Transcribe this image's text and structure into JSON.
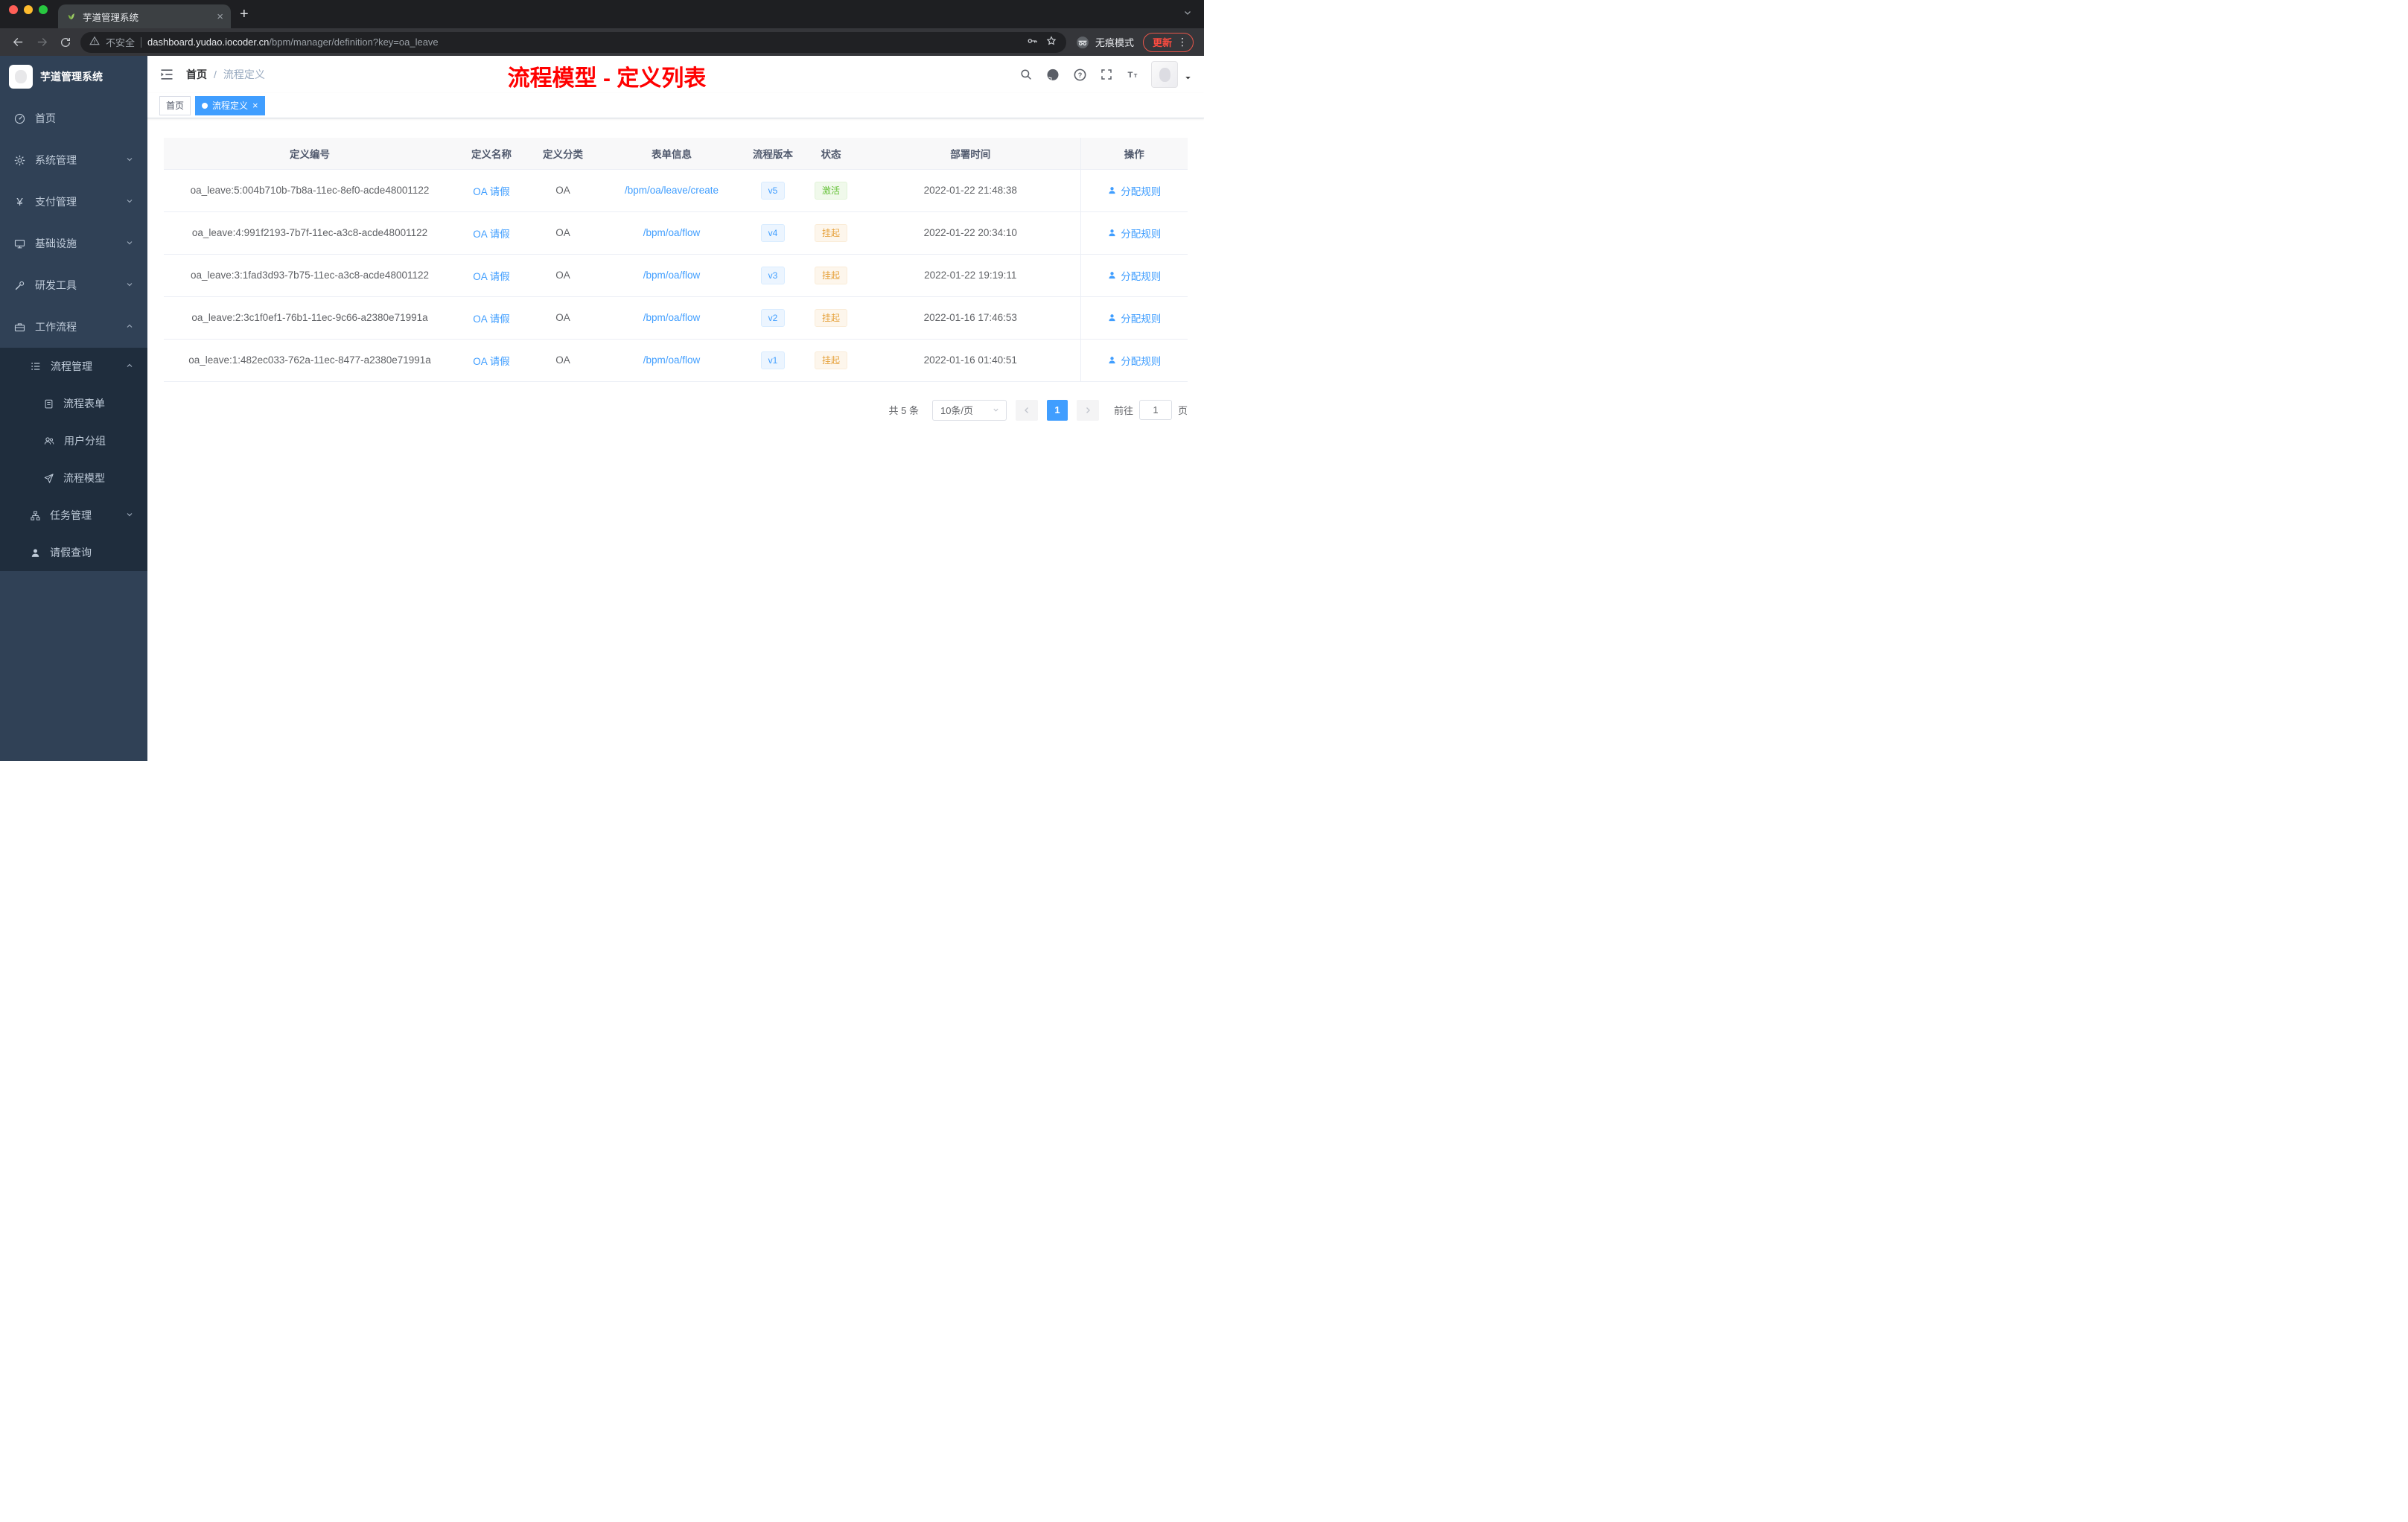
{
  "icons": {
    "close": "×",
    "new_tab": "+",
    "more_vertical": "⋮",
    "yen": "¥",
    "breadcrumb_separator": "/"
  },
  "browser": {
    "tab_title": "芋道管理系统",
    "security_label": "不安全",
    "url_host": "dashboard.yudao.iocoder.cn",
    "url_path": "/bpm/manager/definition?key=oa_leave",
    "incognito_label": "无痕模式",
    "update_label": "更新"
  },
  "sidebar": {
    "logo_title": "芋道管理系统",
    "items": [
      {
        "label": "首页"
      },
      {
        "label": "系统管理"
      },
      {
        "label": "支付管理"
      },
      {
        "label": "基础设施"
      },
      {
        "label": "研发工具"
      },
      {
        "label": "工作流程"
      },
      {
        "label": "流程管理"
      },
      {
        "label": "流程表单"
      },
      {
        "label": "用户分组"
      },
      {
        "label": "流程模型"
      },
      {
        "label": "任务管理"
      },
      {
        "label": "请假查询"
      }
    ]
  },
  "header": {
    "breadcrumb_home": "首页",
    "breadcrumb_current": "流程定义",
    "annotation": "流程模型 - 定义列表"
  },
  "tags": {
    "home": "首页",
    "current": "流程定义"
  },
  "table": {
    "columns": [
      "定义编号",
      "定义名称",
      "定义分类",
      "表单信息",
      "流程版本",
      "状态",
      "部署时间",
      "操作"
    ],
    "rows": [
      {
        "id": "oa_leave:5:004b710b-7b8a-11ec-8ef0-acde48001122",
        "name": "OA 请假",
        "category": "OA",
        "form": "/bpm/oa/leave/create",
        "version": "v5",
        "status": "激活",
        "time": "2022-01-22 21:48:38",
        "action": "分配规则"
      },
      {
        "id": "oa_leave:4:991f2193-7b7f-11ec-a3c8-acde48001122",
        "name": "OA 请假",
        "category": "OA",
        "form": "/bpm/oa/flow",
        "version": "v4",
        "status": "挂起",
        "time": "2022-01-22 20:34:10",
        "action": "分配规则"
      },
      {
        "id": "oa_leave:3:1fad3d93-7b75-11ec-a3c8-acde48001122",
        "name": "OA 请假",
        "category": "OA",
        "form": "/bpm/oa/flow",
        "version": "v3",
        "status": "挂起",
        "time": "2022-01-22 19:19:11",
        "action": "分配规则"
      },
      {
        "id": "oa_leave:2:3c1f0ef1-76b1-11ec-9c66-a2380e71991a",
        "name": "OA 请假",
        "category": "OA",
        "form": "/bpm/oa/flow",
        "version": "v2",
        "status": "挂起",
        "time": "2022-01-16 17:46:53",
        "action": "分配规则"
      },
      {
        "id": "oa_leave:1:482ec033-762a-11ec-8477-a2380e71991a",
        "name": "OA 请假",
        "category": "OA",
        "form": "/bpm/oa/flow",
        "version": "v1",
        "status": "挂起",
        "time": "2022-01-16 01:40:51",
        "action": "分配规则"
      }
    ]
  },
  "pagination": {
    "total": "共 5 条",
    "page_size": "10条/页",
    "current_page": "1",
    "goto_label": "前往",
    "goto_value": "1",
    "page_unit": "页"
  },
  "colors": {
    "primary": "#409eff",
    "success": "#67c23a",
    "warning": "#e6a23c",
    "annotation": "#ff0000",
    "sidebar_bg": "#304156",
    "submenu_bg": "#1f2d3d"
  }
}
